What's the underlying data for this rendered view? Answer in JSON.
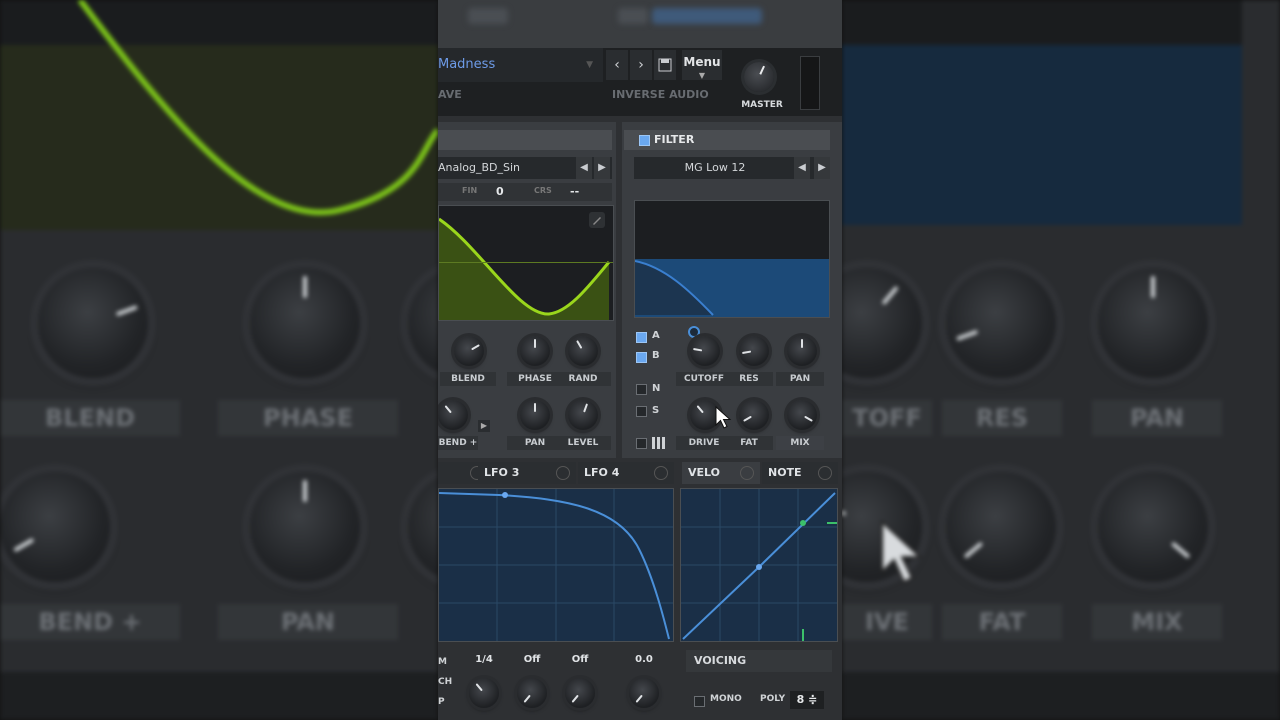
{
  "preset": {
    "name": "Madness",
    "sub_left": "AVE",
    "author": "INVERSE AUDIO",
    "prev_label": "‹",
    "next_label": "›",
    "menu_label": "Menu",
    "master_label": "MASTER"
  },
  "osc": {
    "wavetable": "Analog_BD_Sin",
    "fin_label": "FIN",
    "fin_value": "0",
    "crs_label": "CRS",
    "crs_value": "--",
    "knobs": [
      "BLEND",
      "PHASE",
      "RAND",
      "BEND +",
      "PAN",
      "LEVEL"
    ],
    "wave_color": "#9ad61c"
  },
  "filter": {
    "title": "FILTER",
    "type": "MG Low 12",
    "routing": [
      "A",
      "B",
      "N",
      "S"
    ],
    "knobs": [
      "CUTOFF",
      "RES",
      "PAN",
      "DRIVE",
      "FAT",
      "MIX"
    ],
    "curve_color": "#3a7fcf"
  },
  "mod_tabs": [
    "LFO 3",
    "LFO 4",
    "VELO",
    "NOTE"
  ],
  "lfo": {
    "values": [
      "1/4",
      "Off",
      "Off",
      "0.0"
    ],
    "row_labels": [
      "M",
      "CH",
      "P"
    ]
  },
  "voicing": {
    "title": "VOICING",
    "mono_label": "MONO",
    "poly_label": "POLY",
    "poly_value": "8 ≑"
  },
  "background": {
    "left_labels": [
      "BLEND",
      "PHASE",
      "BEND +",
      "PAN"
    ],
    "right_labels": [
      "TOFF",
      "RES",
      "PAN",
      "IVE",
      "FAT",
      "MIX"
    ]
  },
  "colors": {
    "accent_blue": "#6d9be8",
    "lfo_curve": "#4a8fd8",
    "velo_point": "#3cc06a"
  }
}
